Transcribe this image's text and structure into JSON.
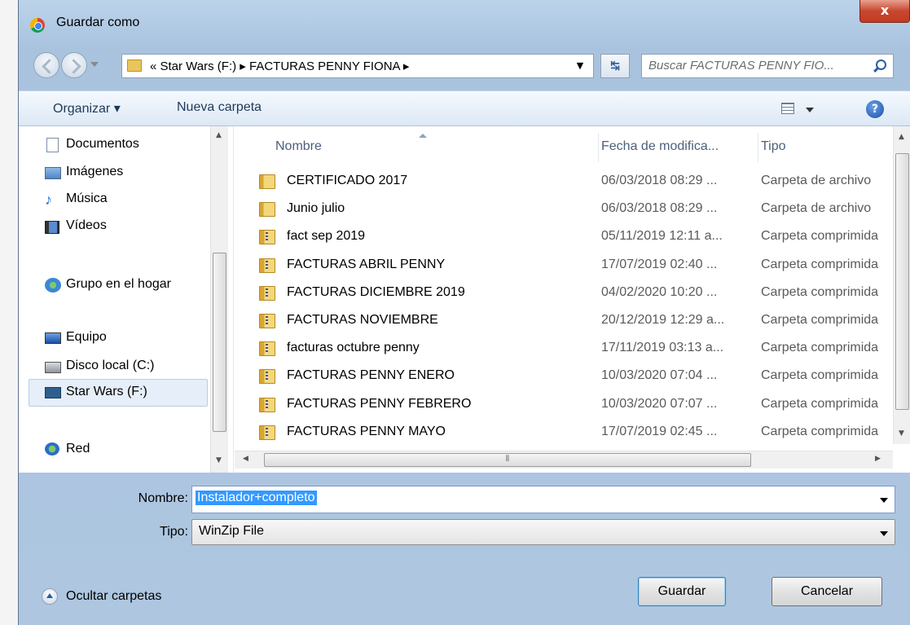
{
  "window": {
    "title": "Guardar como",
    "close_label": "x"
  },
  "nav": {
    "breadcrumb": "« Star Wars (F:) ▸ FACTURAS PENNY FIONA ▸",
    "search_placeholder": "Buscar FACTURAS PENNY FIO..."
  },
  "toolbar": {
    "organize_label": "Organizar ▾",
    "new_folder_label": "Nueva carpeta",
    "help_label": "?"
  },
  "sidebar": {
    "items": [
      {
        "label": "Documentos",
        "icon": "document-icon"
      },
      {
        "label": "Imágenes",
        "icon": "pictures-icon"
      },
      {
        "label": "Música",
        "icon": "music-icon"
      },
      {
        "label": "Vídeos",
        "icon": "video-icon"
      },
      {
        "label": "Grupo en el hogar",
        "icon": "homegroup-icon"
      },
      {
        "label": "Equipo",
        "icon": "computer-icon"
      },
      {
        "label": "Disco local (C:)",
        "icon": "local-disk-icon"
      },
      {
        "label": "Star Wars (F:)",
        "icon": "usb-drive-icon"
      },
      {
        "label": "Red",
        "icon": "network-icon"
      }
    ],
    "selected": "Star Wars (F:)"
  },
  "files": {
    "columns": {
      "name": "Nombre",
      "date": "Fecha de modifica...",
      "type": "Tipo"
    },
    "rows": [
      {
        "name": "CERTIFICADO 2017",
        "date": "06/03/2018 08:29 ...",
        "type": "Carpeta de archivo",
        "kind": "folder"
      },
      {
        "name": "Junio julio",
        "date": "06/03/2018 08:29 ...",
        "type": "Carpeta de archivo",
        "kind": "folder"
      },
      {
        "name": "fact sep 2019",
        "date": "05/11/2019 12:11 a...",
        "type": "Carpeta comprimida",
        "kind": "zip"
      },
      {
        "name": "FACTURAS ABRIL PENNY",
        "date": "17/07/2019 02:40 ...",
        "type": "Carpeta comprimida",
        "kind": "zip"
      },
      {
        "name": "FACTURAS DICIEMBRE 2019",
        "date": "04/02/2020 10:20 ...",
        "type": "Carpeta comprimida",
        "kind": "zip"
      },
      {
        "name": "FACTURAS NOVIEMBRE",
        "date": "20/12/2019 12:29 a...",
        "type": "Carpeta comprimida",
        "kind": "zip"
      },
      {
        "name": "facturas octubre penny",
        "date": "17/11/2019 03:13 a...",
        "type": "Carpeta comprimida",
        "kind": "zip"
      },
      {
        "name": "FACTURAS PENNY ENERO",
        "date": "10/03/2020 07:04 ...",
        "type": "Carpeta comprimida",
        "kind": "zip"
      },
      {
        "name": "FACTURAS PENNY FEBRERO",
        "date": "10/03/2020 07:07 ...",
        "type": "Carpeta comprimida",
        "kind": "zip"
      },
      {
        "name": "FACTURAS PENNY MAYO",
        "date": "17/07/2019 02:45 ...",
        "type": "Carpeta comprimida",
        "kind": "zip"
      }
    ]
  },
  "form": {
    "name_label": "Nombre:",
    "name_value": "Instalador+completo",
    "type_label": "Tipo:",
    "type_value": "WinZip File"
  },
  "footer": {
    "hide_folders_label": "Ocultar carpetas",
    "save_label": "Guardar",
    "cancel_label": "Cancelar"
  }
}
